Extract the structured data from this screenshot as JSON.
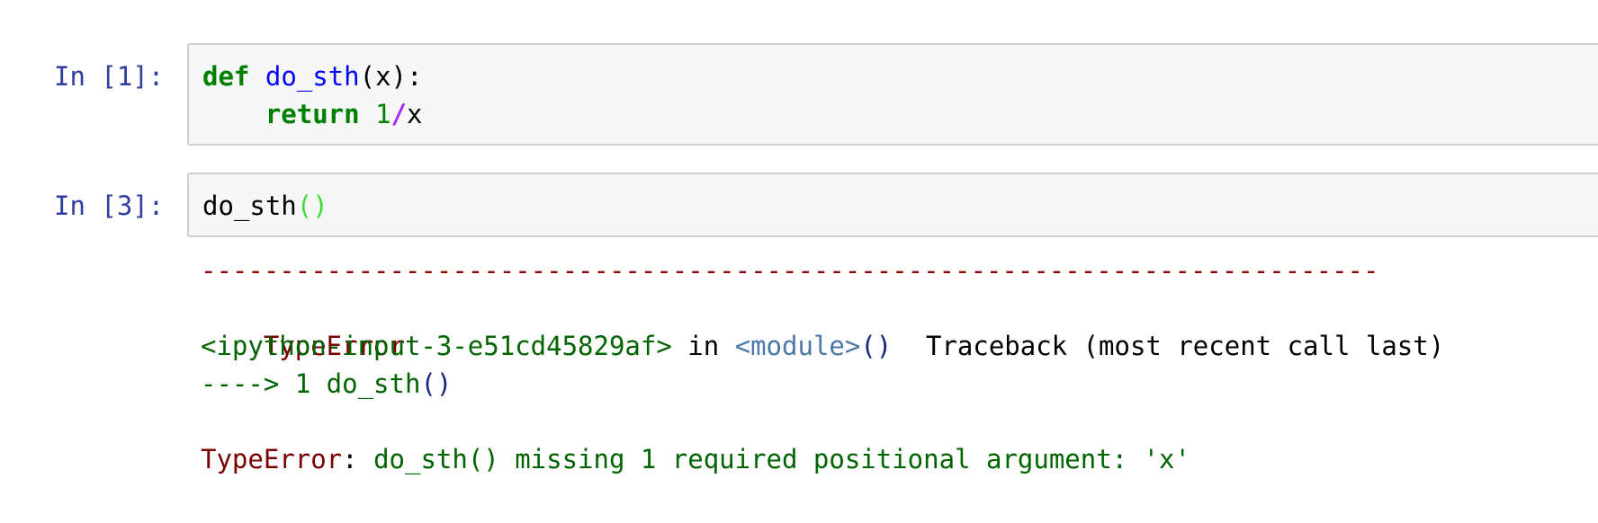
{
  "cells": [
    {
      "prompt": "In [1]:",
      "code": {
        "line1": {
          "kw": "def",
          "fn": "do_sth",
          "rest": "(x):"
        },
        "line2": {
          "indent": "    ",
          "kw": "return",
          "num": "1",
          "op": "/",
          "var": "x"
        }
      }
    },
    {
      "prompt": "In [3]:",
      "code": {
        "call": "do_sth",
        "parens": "()"
      }
    }
  ],
  "traceback": {
    "dashes": "---------------------------------------------------------------------------",
    "error_type": "TypeError",
    "header_right": "Traceback (most recent call last)",
    "location_input": "<ipython-input-3-e51cd45829af>",
    "location_in": " in ",
    "location_module": "<module>",
    "location_parens": "()",
    "arrow_line": "----> 1 do_sth",
    "arrow_parens": "()",
    "error_label": "TypeError",
    "error_colon": ": ",
    "error_message": "do_sth() missing 1 required positional argument: 'x'"
  },
  "colors": {
    "prompt": "#303f9f",
    "keyword": "#008000",
    "function": "#0000ff",
    "operator": "#aa22ff",
    "error": "#8b0000",
    "traceback_text": "#006400",
    "cell_background": "#f7f7f7",
    "cell_border": "#cfcfcf"
  }
}
